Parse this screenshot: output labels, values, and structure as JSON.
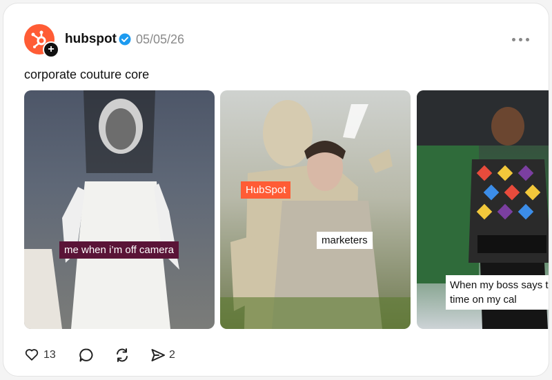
{
  "post": {
    "username": "hubspot",
    "date": "05/05/26",
    "caption": "corporate couture core",
    "verified": true
  },
  "slides": [
    {
      "overlay_text": "me when i’m off camera"
    },
    {
      "overlay_text_1": "HubSpot",
      "overlay_text_2": "marketers"
    },
    {
      "overlay_text": "When my boss says t some time on my cal"
    }
  ],
  "actions": {
    "likes": "13",
    "shares": "2"
  },
  "colors": {
    "brand": "#ff5c35",
    "verified": "#1d9bf0"
  }
}
